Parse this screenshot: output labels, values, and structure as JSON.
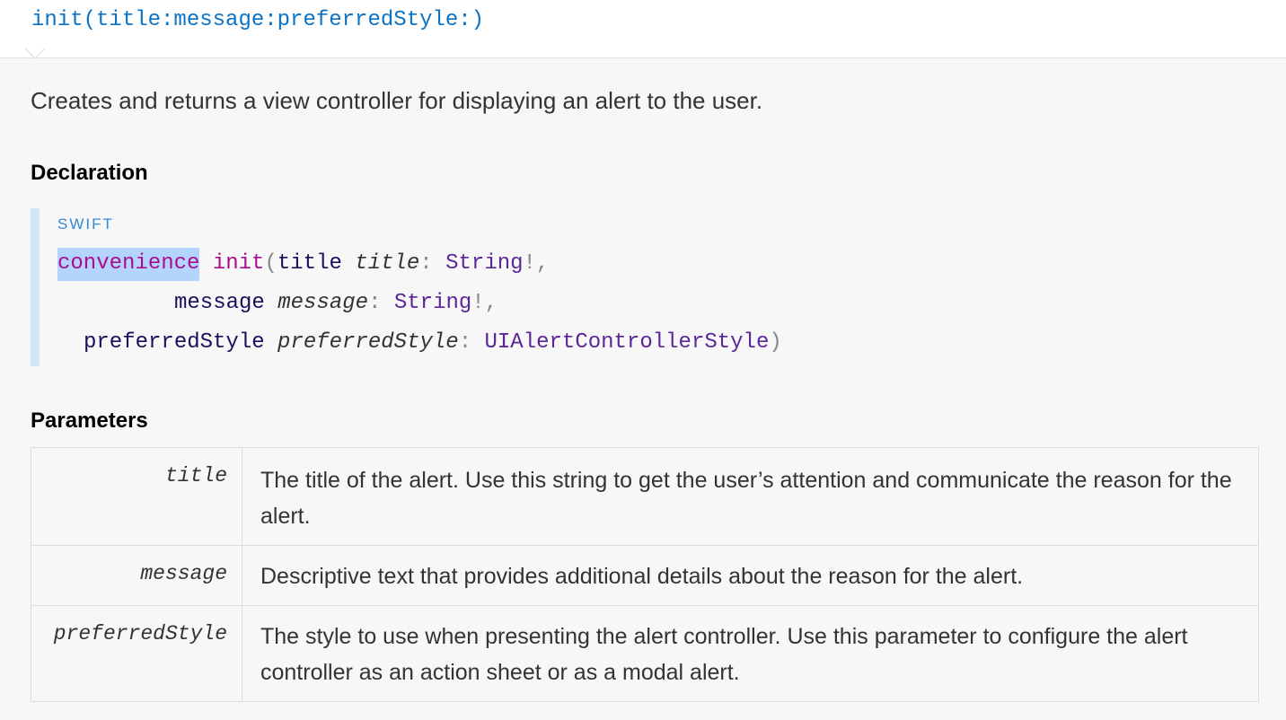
{
  "header": {
    "title": "init(title:message:preferredStyle:)"
  },
  "abstract": "Creates and returns a view controller for displaying an alert to the user.",
  "declaration": {
    "heading": "Declaration",
    "language": "SWIFT",
    "line1": {
      "keyword": "convenience",
      "space1": " ",
      "func": "init",
      "paren_open": "(",
      "ext_label": "title",
      "space2": " ",
      "int_label": "title",
      "colon": ":",
      "space3": " ",
      "type": "String",
      "suffix": "!,"
    },
    "line2": {
      "ext_label": "message",
      "space1": " ",
      "int_label": "message",
      "colon": ":",
      "space2": " ",
      "type": "String",
      "suffix": "!,"
    },
    "line3": {
      "ext_label": "preferredStyle",
      "space1": " ",
      "int_label": "preferredStyle",
      "colon": ":",
      "space2": " ",
      "type": "UIAlertControllerStyle",
      "suffix": ")"
    },
    "highlight_color": "#b3d4fd"
  },
  "parameters": {
    "heading": "Parameters",
    "rows": [
      {
        "name": "title",
        "description": "The title of the alert. Use this string to get the user’s attention and communicate the reason for the alert."
      },
      {
        "name": "message",
        "description": "Descriptive text that provides additional details about the reason for the alert."
      },
      {
        "name": "preferredStyle",
        "description": "The style to use when presenting the alert controller. Use this parameter to configure the alert controller as an action sheet or as a modal alert."
      }
    ]
  },
  "colors": {
    "link": "#0a73c6",
    "keyword": "#aa0d91",
    "type": "#5c2699",
    "code_bar": "#cfe6f3"
  }
}
